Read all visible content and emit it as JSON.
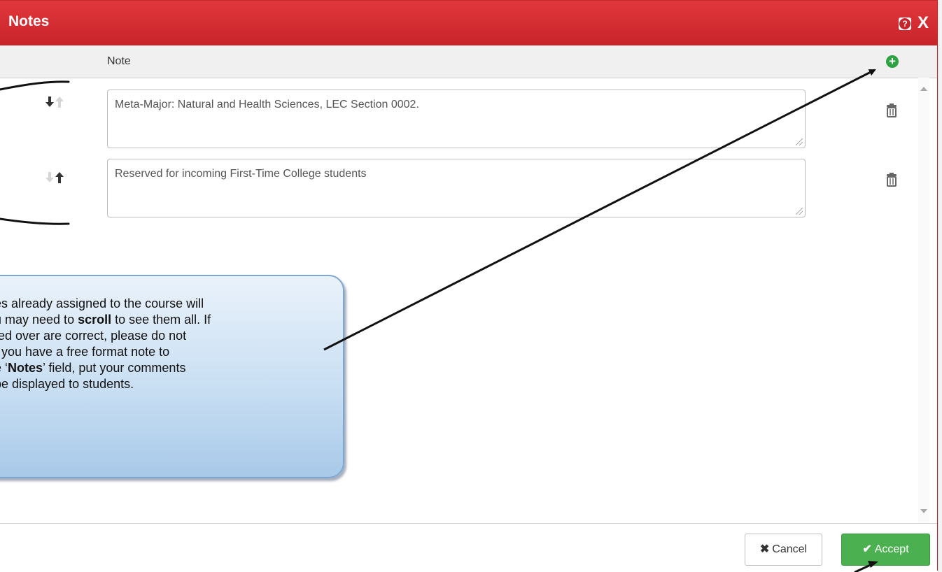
{
  "dialog": {
    "title": "Notes",
    "help_icon": "help-icon",
    "close_icon": "close-icon",
    "close_glyph": "X",
    "column_header": "Note",
    "add_icon": "plus-circle-icon"
  },
  "notes": [
    {
      "text": "Meta-Major:  Natural and Health Sciences, LEC Section 0002.",
      "move_down_enabled": true,
      "move_up_enabled": false
    },
    {
      "text": "Reserved for incoming First-Time College students",
      "move_down_enabled": false,
      "move_up_enabled": true
    }
  ],
  "footer": {
    "cancel_label": "Cancel",
    "cancel_icon": "x-icon",
    "accept_label": "Accept",
    "accept_icon": "check-icon"
  },
  "callout": {
    "lines": [
      [
        "es already assigned to the course will"
      ],
      [
        "u may need to ",
        {
          "b": "scroll"
        },
        " to see them all. If"
      ],
      [
        "fed over are correct, please do not"
      ],
      [
        "f you have a free format note to"
      ],
      [
        "e ‘",
        {
          "b": "Notes"
        },
        "’ field, put your comments"
      ],
      [
        " be displayed to students."
      ]
    ]
  },
  "colors": {
    "titlebar": "#c8242a",
    "accept": "#4bb04f",
    "add": "#2ea344"
  }
}
